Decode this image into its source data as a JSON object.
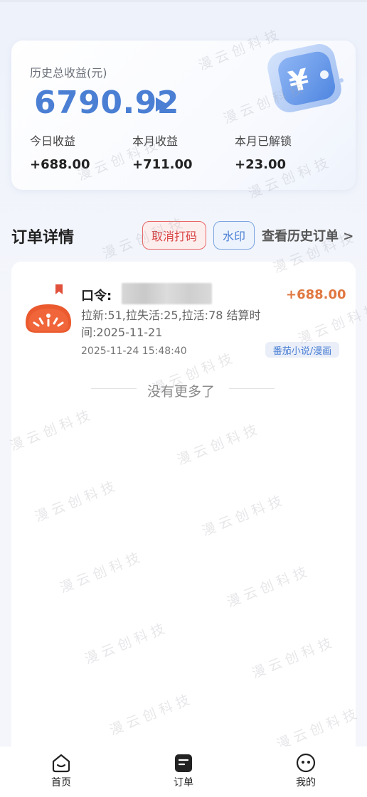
{
  "earnings": {
    "total_label": "历史总收益(元)",
    "total_value": "6790.92",
    "today_label": "今日收益",
    "today_value": "+688.00",
    "month_label": "本月收益",
    "month_value": "+711.00",
    "unlocked_label": "本月已解锁",
    "unlocked_value": "+23.00"
  },
  "orders_section": {
    "title": "订单详情",
    "cancel_button": "取消打码",
    "watermark_button": "水印",
    "history_link": "查看历史订单 >"
  },
  "order": {
    "command_label": "口令:",
    "amount": "+688.00",
    "description": "拉新:51,拉失活:25,拉活:78 结算时间:2025-11-21",
    "timestamp": "2025-11-24 15:48:40",
    "tag": "番茄小说/漫画"
  },
  "no_more": "没有更多了",
  "tabs": [
    {
      "label": "首页",
      "icon": "home-icon"
    },
    {
      "label": "订单",
      "icon": "order-icon"
    },
    {
      "label": "我的",
      "icon": "profile-icon"
    }
  ],
  "watermark_text": "漫云创科技",
  "colors": {
    "accent": "#4a7fd4",
    "amount": "#e07840",
    "cancel": "#d94444"
  }
}
